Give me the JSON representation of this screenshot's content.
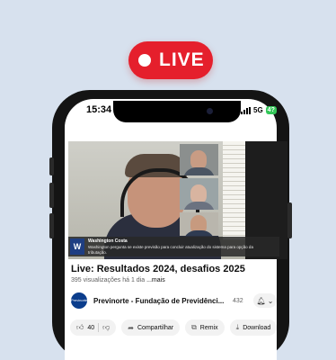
{
  "live_badge": {
    "label": "LIVE"
  },
  "status_bar": {
    "time": "15:34",
    "network": "5G",
    "battery": "4?"
  },
  "video": {
    "lower_third_logo": "W",
    "lower_third_name": "Washington Costa",
    "lower_third_text": "Washington pergunta se existe previsão para concluir atualização do sistema para opção da tributação.",
    "title": "Live: Resultados 2024, desafios 2025",
    "views": "395 visualizações",
    "age": "há 1 dia",
    "more_label": "...mais"
  },
  "channel": {
    "name": "Previnorte - Fundação de Previdênci...",
    "subscribers": "432",
    "avatar_text": "Previnorte"
  },
  "actions": {
    "like_count": "40",
    "share_label": "Compartilhar",
    "remix_label": "Remix",
    "download_label": "Download"
  },
  "colors": {
    "live_red": "#e51f2c",
    "page_bg": "#d7e1ee",
    "phone": "#141414"
  }
}
